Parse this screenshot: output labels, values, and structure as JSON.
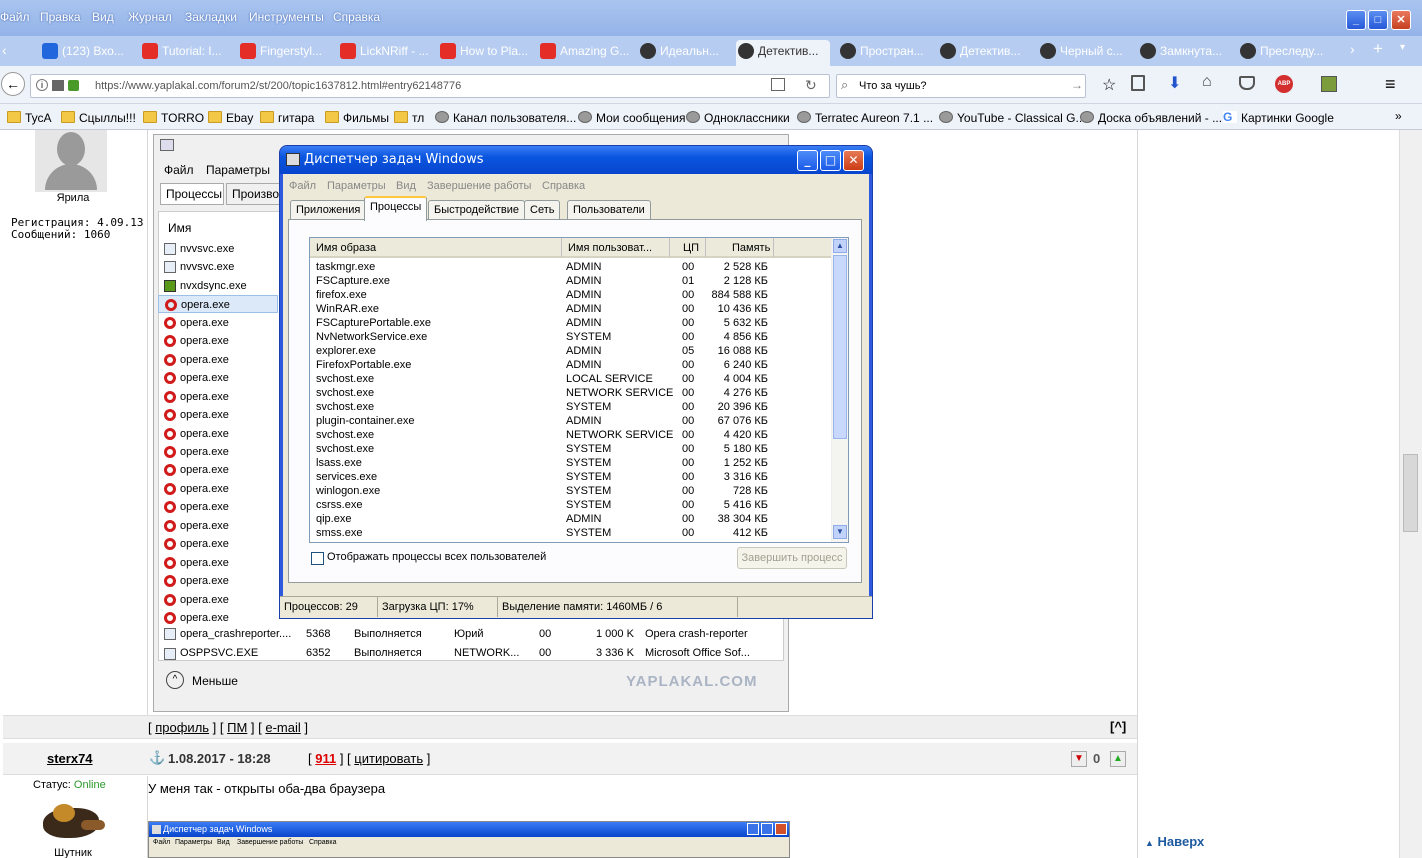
{
  "menubar": {
    "items": [
      "Файл",
      "Правка",
      "Вид",
      "Журнал",
      "Закладки",
      "Инструменты",
      "Справка"
    ]
  },
  "tabs": [
    {
      "label": "(123) Вхо...",
      "icon": "mail-icon",
      "color": "#2266dd"
    },
    {
      "label": "Tutorial: I...",
      "icon": "youtube-icon",
      "color": "#e52d27"
    },
    {
      "label": "Fingerstyl...",
      "icon": "youtube-icon",
      "color": "#e52d27"
    },
    {
      "label": "LickNRiff - ...",
      "icon": "youtube-icon",
      "color": "#e52d27"
    },
    {
      "label": "How to Pla...",
      "icon": "youtube-icon",
      "color": "#e52d27"
    },
    {
      "label": "Amazing G...",
      "icon": "youtube-icon",
      "color": "#e52d27"
    },
    {
      "label": "Идеальн...",
      "icon": "yaplakal-icon",
      "color": "#333"
    },
    {
      "label": "Детектив...",
      "icon": "yaplakal-icon",
      "color": "#333"
    },
    {
      "label": "Простран...",
      "icon": "yaplakal-icon",
      "color": "#333"
    },
    {
      "label": "Детектив...",
      "icon": "yaplakal-icon",
      "color": "#333"
    },
    {
      "label": "Черный с...",
      "icon": "yaplakal-icon",
      "color": "#333"
    },
    {
      "label": "Замкнута...",
      "icon": "yaplakal-icon",
      "color": "#333"
    },
    {
      "label": "Преследу...",
      "icon": "yaplakal-icon",
      "color": "#333"
    }
  ],
  "nav": {
    "url": "https://www.yaplakal.com/forum2/st/200/topic1637812.html#entry62148776",
    "search": "Что за чушь?"
  },
  "bookmarks": [
    {
      "label": "ТусА",
      "icon": "folder"
    },
    {
      "label": "Сцыллы!!!",
      "icon": "folder"
    },
    {
      "label": "TORRO",
      "icon": "folder"
    },
    {
      "label": "Ebay",
      "icon": "folder"
    },
    {
      "label": "гитара",
      "icon": "folder"
    },
    {
      "label": "Фильмы",
      "icon": "folder"
    },
    {
      "label": "тл",
      "icon": "folder"
    },
    {
      "label": "Канал пользователя...",
      "icon": "globe"
    },
    {
      "label": "Мои сообщения",
      "icon": "globe"
    },
    {
      "label": "Одноклассники",
      "icon": "globe"
    },
    {
      "label": "Terratec Aureon 7.1 ...",
      "icon": "globe"
    },
    {
      "label": "YouTube - Classical G...",
      "icon": "globe"
    },
    {
      "label": "Доска объявлений - ...",
      "icon": "globe"
    },
    {
      "label": "Картинки Google",
      "icon": "google"
    }
  ],
  "post1": {
    "username": "Ярила",
    "reg": "Регистрация: 4.09.13",
    "messages": "Сообщений: 1060"
  },
  "bgtm": {
    "menu_file": "Файл",
    "menu_params": "Параметры",
    "tab1": "Процессы",
    "tab2": "Произво",
    "col_name": "Имя",
    "rows": [
      "nvvsvc.exe",
      "nvvsvc.exe",
      "nvxdsync.exe",
      "opera.exe",
      "opera.exe",
      "opera.exe",
      "opera.exe",
      "opera.exe",
      "opera.exe",
      "opera.exe",
      "opera.exe",
      "opera.exe",
      "opera.exe",
      "opera.exe",
      "opera.exe",
      "opera.exe",
      "opera.exe",
      "opera.exe",
      "opera.exe",
      "opera.exe",
      "opera.exe"
    ],
    "row_crash": {
      "name": "opera_crashreporter....",
      "pid": "5368",
      "status": "Выполняется",
      "user": "Юрий",
      "cpu": "00",
      "mem": "1 000 K",
      "desc": "Opera crash-reporter"
    },
    "row_ospp": {
      "name": "OSPPSVC.EXE",
      "pid": "6352",
      "status": "Выполняется",
      "user": "NETWORK...",
      "cpu": "00",
      "mem": "3 336 K",
      "desc": "Microsoft Office Sof..."
    },
    "less": "Меньше",
    "watermark": "YAPLAKAL.COM"
  },
  "xptm": {
    "title": "Диспетчер задач Windows",
    "menu": [
      "Файл",
      "Параметры",
      "Вид",
      "Завершение работы",
      "Справка"
    ],
    "tabs": [
      "Приложения",
      "Процессы",
      "Быстродействие",
      "Сеть",
      "Пользователи"
    ],
    "headers": {
      "name": "Имя образа",
      "user": "Имя пользоват...",
      "cpu": "ЦП",
      "mem": "Память"
    },
    "processes": [
      {
        "name": "taskmgr.exe",
        "user": "ADMIN",
        "cpu": "00",
        "mem": "2 528 КБ"
      },
      {
        "name": "FSCapture.exe",
        "user": "ADMIN",
        "cpu": "01",
        "mem": "2 128 КБ"
      },
      {
        "name": "firefox.exe",
        "user": "ADMIN",
        "cpu": "00",
        "mem": "884 588 КБ"
      },
      {
        "name": "WinRAR.exe",
        "user": "ADMIN",
        "cpu": "00",
        "mem": "10 436 КБ"
      },
      {
        "name": "FSCapturePortable.exe",
        "user": "ADMIN",
        "cpu": "00",
        "mem": "5 632 КБ"
      },
      {
        "name": "NvNetworkService.exe",
        "user": "SYSTEM",
        "cpu": "00",
        "mem": "4 856 КБ"
      },
      {
        "name": "explorer.exe",
        "user": "ADMIN",
        "cpu": "05",
        "mem": "16 088 КБ"
      },
      {
        "name": "FirefoxPortable.exe",
        "user": "ADMIN",
        "cpu": "00",
        "mem": "6 240 КБ"
      },
      {
        "name": "svchost.exe",
        "user": "LOCAL SERVICE",
        "cpu": "00",
        "mem": "4 004 КБ"
      },
      {
        "name": "svchost.exe",
        "user": "NETWORK SERVICE",
        "cpu": "00",
        "mem": "4 276 КБ"
      },
      {
        "name": "svchost.exe",
        "user": "SYSTEM",
        "cpu": "00",
        "mem": "20 396 КБ"
      },
      {
        "name": "plugin-container.exe",
        "user": "ADMIN",
        "cpu": "00",
        "mem": "67 076 КБ"
      },
      {
        "name": "svchost.exe",
        "user": "NETWORK SERVICE",
        "cpu": "00",
        "mem": "4 420 КБ"
      },
      {
        "name": "svchost.exe",
        "user": "SYSTEM",
        "cpu": "00",
        "mem": "5 180 КБ"
      },
      {
        "name": "lsass.exe",
        "user": "SYSTEM",
        "cpu": "00",
        "mem": "1 252 КБ"
      },
      {
        "name": "services.exe",
        "user": "SYSTEM",
        "cpu": "00",
        "mem": "3 316 КБ"
      },
      {
        "name": "winlogon.exe",
        "user": "SYSTEM",
        "cpu": "00",
        "mem": "728 КБ"
      },
      {
        "name": "csrss.exe",
        "user": "SYSTEM",
        "cpu": "00",
        "mem": "5 416 КБ"
      },
      {
        "name": "qip.exe",
        "user": "ADMIN",
        "cpu": "00",
        "mem": "38 304 КБ"
      },
      {
        "name": "smss.exe",
        "user": "SYSTEM",
        "cpu": "00",
        "mem": "412 КБ"
      }
    ],
    "show_all": "Отображать процессы всех пользователей",
    "end_process": "Завершить процесс",
    "status": {
      "procs": "Процессов: 29",
      "cpu": "Загрузка ЦП: 17%",
      "mem": "Выделение памяти: 1460МБ / 6"
    }
  },
  "postlinks": {
    "profile": "профиль",
    "pm": "ПМ",
    "email": "e-mail",
    "up": "[^]"
  },
  "post2": {
    "username": "sterx74",
    "date": "1.08.2017 - 18:28",
    "rating": "911",
    "quote": "цитировать",
    "status_label": "Статус:",
    "status_value": "Online",
    "rank": "Шутник",
    "text": "У меня так - открыты оба-два браузера",
    "votes": "0",
    "thumb_title": "Диспетчер задач Windows",
    "thumb_menu": [
      "Файл",
      "Параметры",
      "Вид",
      "Завершение работы",
      "Справка"
    ]
  },
  "totop": "Наверх"
}
